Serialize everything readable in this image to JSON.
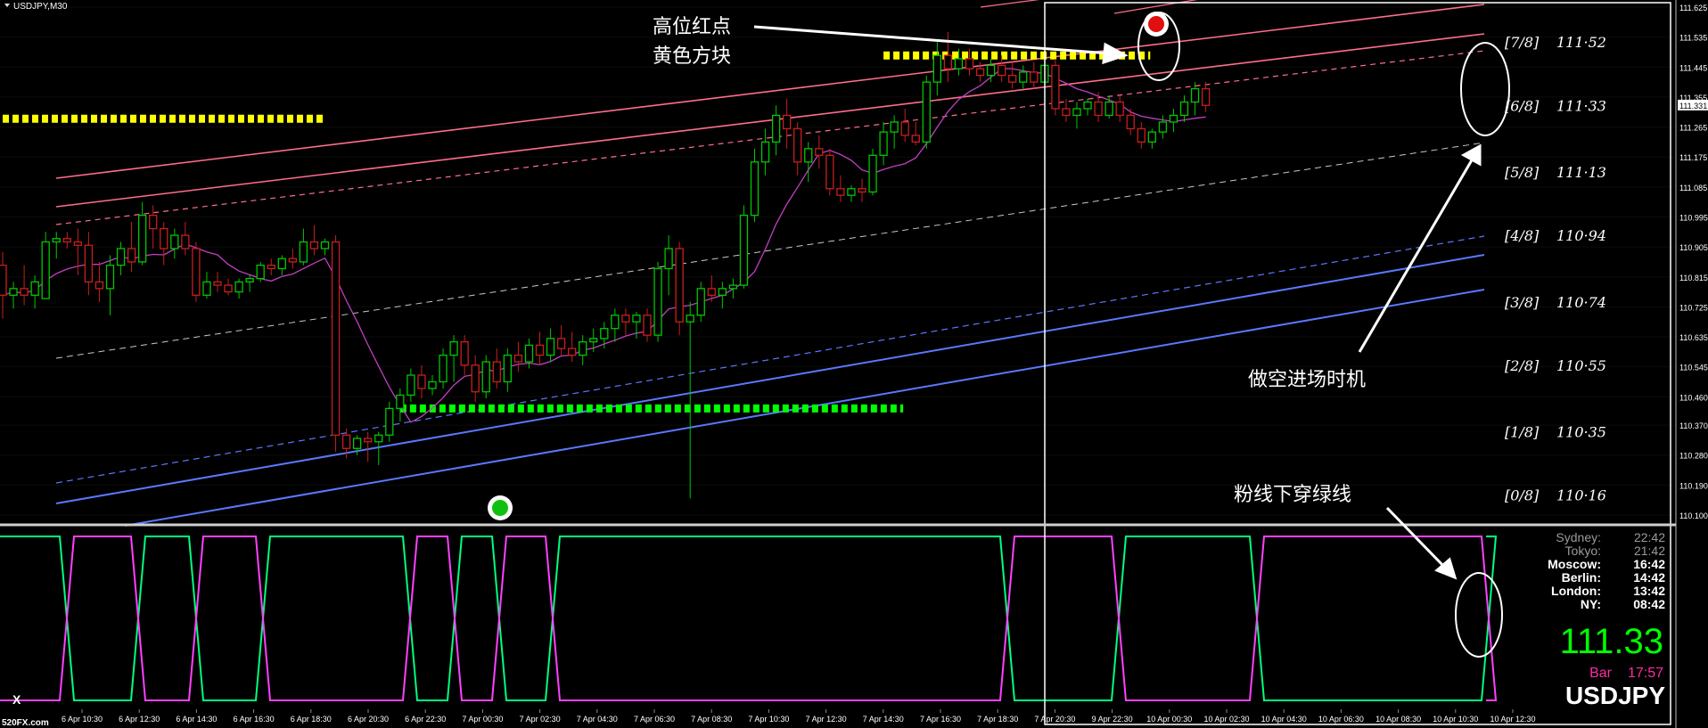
{
  "window": {
    "title": "USDJPY,M30",
    "watermark": "520FX.com",
    "close_label": "X"
  },
  "annotations": {
    "high_red_dot": "高位红点",
    "yellow_block": "黄色方块",
    "short_entry": "做空进场时机",
    "pink_cross_green": "粉线下穿绿线"
  },
  "murrey_levels": [
    {
      "label": "[7/8]",
      "value": "111·52"
    },
    {
      "label": "[6/8]",
      "value": "111·33"
    },
    {
      "label": "[5/8]",
      "value": "111·13"
    },
    {
      "label": "[4/8]",
      "value": "110·94"
    },
    {
      "label": "[3/8]",
      "value": "110·74"
    },
    {
      "label": "[2/8]",
      "value": "110·55"
    },
    {
      "label": "[1/8]",
      "value": "110·35"
    },
    {
      "label": "[0/8]",
      "value": "110·16"
    }
  ],
  "world_clock": [
    {
      "city": "Sydney:",
      "time": "22:42",
      "color": "#9a9a9a"
    },
    {
      "city": "Tokyo:",
      "time": "21:42",
      "color": "#9a9a9a"
    },
    {
      "city": "Moscow:",
      "time": "16:42",
      "color": "#ffffff"
    },
    {
      "city": "Berlin:",
      "time": "14:42",
      "color": "#ffffff"
    },
    {
      "city": "London:",
      "time": "13:42",
      "color": "#ffffff"
    },
    {
      "city": "NY:",
      "time": "08:42",
      "color": "#ffffff"
    }
  ],
  "price_panel": {
    "price": "111.33",
    "bar_label": "Bar",
    "bar_time": "17:57",
    "symbol": "USDJPY"
  },
  "colors": {
    "background": "#000000",
    "bull_candle": "#00c800",
    "bear_candle": "#c81e1e",
    "pink_channel": "#ff6e8c",
    "blue_channel": "#5a78ff",
    "yellow_blocks": "#ffff00",
    "green_blocks": "#00ff00",
    "ma_line": "#c040c0",
    "osc_green": "#00ff7f",
    "osc_pink": "#ff40ff"
  },
  "chart_data": {
    "type": "candlestick",
    "symbol": "USDJPY",
    "timeframe": "M30",
    "ylim": [
      110.1,
      111.625
    ],
    "y_ticks": [
      111.625,
      111.535,
      111.445,
      111.355,
      111.265,
      111.175,
      111.085,
      110.995,
      110.905,
      110.815,
      110.725,
      110.635,
      110.545,
      110.455,
      110.37,
      110.28,
      110.19,
      110.1
    ],
    "y_tick_labels": [
      "111.625",
      "111.535",
      "111.445",
      "111.355",
      "111.265",
      "111.175",
      "111.085",
      "110.995",
      "110.905",
      "110.815",
      "110.725",
      "110.635",
      "110.545",
      "110.460",
      "110.370",
      "110.280",
      "110.190",
      "110.100"
    ],
    "current_price": 111.331,
    "current_price_label": "111.331",
    "x_tick_labels": [
      "6 Apr 10:30",
      "6 Apr 12:30",
      "6 Apr 14:30",
      "6 Apr 16:30",
      "6 Apr 18:30",
      "6 Apr 20:30",
      "6 Apr 22:30",
      "7 Apr 00:30",
      "7 Apr 02:30",
      "7 Apr 04:30",
      "7 Apr 06:30",
      "7 Apr 08:30",
      "7 Apr 10:30",
      "7 Apr 12:30",
      "7 Apr 14:30",
      "7 Apr 16:30",
      "7 Apr 18:30",
      "7 Apr 20:30",
      "9 Apr 22:30",
      "10 Apr 00:30",
      "10 Apr 02:30",
      "10 Apr 04:30",
      "10 Apr 06:30",
      "10 Apr 08:30",
      "10 Apr 10:30",
      "10 Apr 12:30"
    ],
    "murrey_values": [
      111.52,
      111.33,
      111.13,
      110.94,
      110.74,
      110.55,
      110.35,
      110.16
    ],
    "yellow_block_levels": [
      {
        "price": 111.29,
        "from_bar": 0,
        "to_bar": 29
      },
      {
        "price": 111.48,
        "from_bar": 82,
        "to_bar": 106
      }
    ],
    "green_block_levels": [
      {
        "price": 110.42,
        "from_bar": 37,
        "to_bar": 83
      }
    ],
    "candles": [
      {
        "o": 110.85,
        "h": 110.89,
        "l": 110.69,
        "c": 110.76
      },
      {
        "o": 110.76,
        "h": 110.8,
        "l": 110.72,
        "c": 110.78
      },
      {
        "o": 110.78,
        "h": 110.85,
        "l": 110.73,
        "c": 110.76
      },
      {
        "o": 110.76,
        "h": 110.82,
        "l": 110.72,
        "c": 110.8
      },
      {
        "o": 110.75,
        "h": 110.95,
        "l": 110.75,
        "c": 110.92
      },
      {
        "o": 110.92,
        "h": 110.95,
        "l": 110.87,
        "c": 110.93
      },
      {
        "o": 110.93,
        "h": 110.95,
        "l": 110.9,
        "c": 110.92
      },
      {
        "o": 110.92,
        "h": 110.96,
        "l": 110.82,
        "c": 110.91
      },
      {
        "o": 110.91,
        "h": 110.95,
        "l": 110.76,
        "c": 110.8
      },
      {
        "o": 110.8,
        "h": 110.86,
        "l": 110.74,
        "c": 110.78
      },
      {
        "o": 110.78,
        "h": 110.88,
        "l": 110.7,
        "c": 110.85
      },
      {
        "o": 110.85,
        "h": 110.92,
        "l": 110.82,
        "c": 110.9
      },
      {
        "o": 110.9,
        "h": 110.98,
        "l": 110.83,
        "c": 110.86
      },
      {
        "o": 110.86,
        "h": 111.04,
        "l": 110.85,
        "c": 111.0
      },
      {
        "o": 111.0,
        "h": 111.03,
        "l": 110.9,
        "c": 110.96
      },
      {
        "o": 110.96,
        "h": 110.98,
        "l": 110.85,
        "c": 110.9
      },
      {
        "o": 110.9,
        "h": 110.96,
        "l": 110.87,
        "c": 110.94
      },
      {
        "o": 110.94,
        "h": 110.98,
        "l": 110.88,
        "c": 110.9
      },
      {
        "o": 110.9,
        "h": 110.92,
        "l": 110.74,
        "c": 110.76
      },
      {
        "o": 110.76,
        "h": 110.83,
        "l": 110.75,
        "c": 110.8
      },
      {
        "o": 110.8,
        "h": 110.83,
        "l": 110.77,
        "c": 110.79
      },
      {
        "o": 110.79,
        "h": 110.81,
        "l": 110.76,
        "c": 110.77
      },
      {
        "o": 110.77,
        "h": 110.81,
        "l": 110.75,
        "c": 110.8
      },
      {
        "o": 110.8,
        "h": 110.82,
        "l": 110.77,
        "c": 110.81
      },
      {
        "o": 110.81,
        "h": 110.86,
        "l": 110.8,
        "c": 110.85
      },
      {
        "o": 110.85,
        "h": 110.87,
        "l": 110.82,
        "c": 110.84
      },
      {
        "o": 110.84,
        "h": 110.88,
        "l": 110.82,
        "c": 110.87
      },
      {
        "o": 110.87,
        "h": 110.9,
        "l": 110.84,
        "c": 110.86
      },
      {
        "o": 110.86,
        "h": 110.96,
        "l": 110.85,
        "c": 110.92
      },
      {
        "o": 110.92,
        "h": 110.97,
        "l": 110.88,
        "c": 110.9
      },
      {
        "o": 110.9,
        "h": 110.93,
        "l": 110.88,
        "c": 110.92
      },
      {
        "o": 110.92,
        "h": 110.94,
        "l": 110.29,
        "c": 110.34
      },
      {
        "o": 110.34,
        "h": 110.36,
        "l": 110.27,
        "c": 110.3
      },
      {
        "o": 110.3,
        "h": 110.34,
        "l": 110.28,
        "c": 110.33
      },
      {
        "o": 110.33,
        "h": 110.35,
        "l": 110.26,
        "c": 110.32
      },
      {
        "o": 110.32,
        "h": 110.35,
        "l": 110.25,
        "c": 110.34
      },
      {
        "o": 110.34,
        "h": 110.44,
        "l": 110.32,
        "c": 110.42
      },
      {
        "o": 110.42,
        "h": 110.48,
        "l": 110.38,
        "c": 110.46
      },
      {
        "o": 110.46,
        "h": 110.54,
        "l": 110.44,
        "c": 110.52
      },
      {
        "o": 110.52,
        "h": 110.55,
        "l": 110.45,
        "c": 110.48
      },
      {
        "o": 110.48,
        "h": 110.52,
        "l": 110.46,
        "c": 110.5
      },
      {
        "o": 110.5,
        "h": 110.6,
        "l": 110.48,
        "c": 110.58
      },
      {
        "o": 110.58,
        "h": 110.64,
        "l": 110.5,
        "c": 110.62
      },
      {
        "o": 110.62,
        "h": 110.64,
        "l": 110.52,
        "c": 110.55
      },
      {
        "o": 110.55,
        "h": 110.58,
        "l": 110.44,
        "c": 110.47
      },
      {
        "o": 110.47,
        "h": 110.58,
        "l": 110.45,
        "c": 110.56
      },
      {
        "o": 110.56,
        "h": 110.6,
        "l": 110.48,
        "c": 110.5
      },
      {
        "o": 110.5,
        "h": 110.6,
        "l": 110.47,
        "c": 110.58
      },
      {
        "o": 110.58,
        "h": 110.62,
        "l": 110.53,
        "c": 110.56
      },
      {
        "o": 110.56,
        "h": 110.63,
        "l": 110.54,
        "c": 110.61
      },
      {
        "o": 110.61,
        "h": 110.65,
        "l": 110.55,
        "c": 110.58
      },
      {
        "o": 110.58,
        "h": 110.66,
        "l": 110.56,
        "c": 110.63
      },
      {
        "o": 110.63,
        "h": 110.67,
        "l": 110.58,
        "c": 110.6
      },
      {
        "o": 110.6,
        "h": 110.65,
        "l": 110.56,
        "c": 110.58
      },
      {
        "o": 110.58,
        "h": 110.64,
        "l": 110.55,
        "c": 110.62
      },
      {
        "o": 110.62,
        "h": 110.66,
        "l": 110.59,
        "c": 110.63
      },
      {
        "o": 110.63,
        "h": 110.68,
        "l": 110.6,
        "c": 110.66
      },
      {
        "o": 110.66,
        "h": 110.72,
        "l": 110.62,
        "c": 110.7
      },
      {
        "o": 110.7,
        "h": 110.72,
        "l": 110.64,
        "c": 110.68
      },
      {
        "o": 110.68,
        "h": 110.71,
        "l": 110.63,
        "c": 110.7
      },
      {
        "o": 110.7,
        "h": 110.72,
        "l": 110.62,
        "c": 110.64
      },
      {
        "o": 110.64,
        "h": 110.86,
        "l": 110.62,
        "c": 110.84
      },
      {
        "o": 110.84,
        "h": 110.94,
        "l": 110.76,
        "c": 110.9
      },
      {
        "o": 110.9,
        "h": 110.92,
        "l": 110.64,
        "c": 110.68
      },
      {
        "o": 110.68,
        "h": 110.74,
        "l": 110.15,
        "c": 110.7
      },
      {
        "o": 110.7,
        "h": 110.8,
        "l": 110.68,
        "c": 110.78
      },
      {
        "o": 110.78,
        "h": 110.82,
        "l": 110.74,
        "c": 110.76
      },
      {
        "o": 110.76,
        "h": 110.8,
        "l": 110.72,
        "c": 110.78
      },
      {
        "o": 110.78,
        "h": 110.81,
        "l": 110.75,
        "c": 110.79
      },
      {
        "o": 110.79,
        "h": 111.03,
        "l": 110.78,
        "c": 111.0
      },
      {
        "o": 111.0,
        "h": 111.2,
        "l": 110.98,
        "c": 111.16
      },
      {
        "o": 111.16,
        "h": 111.26,
        "l": 111.12,
        "c": 111.22
      },
      {
        "o": 111.22,
        "h": 111.33,
        "l": 111.18,
        "c": 111.3
      },
      {
        "o": 111.3,
        "h": 111.35,
        "l": 111.2,
        "c": 111.26
      },
      {
        "o": 111.26,
        "h": 111.28,
        "l": 111.12,
        "c": 111.16
      },
      {
        "o": 111.16,
        "h": 111.22,
        "l": 111.1,
        "c": 111.2
      },
      {
        "o": 111.2,
        "h": 111.24,
        "l": 111.14,
        "c": 111.18
      },
      {
        "o": 111.18,
        "h": 111.2,
        "l": 111.06,
        "c": 111.08
      },
      {
        "o": 111.08,
        "h": 111.12,
        "l": 111.04,
        "c": 111.06
      },
      {
        "o": 111.06,
        "h": 111.09,
        "l": 111.04,
        "c": 111.08
      },
      {
        "o": 111.08,
        "h": 111.11,
        "l": 111.04,
        "c": 111.07
      },
      {
        "o": 111.07,
        "h": 111.2,
        "l": 111.06,
        "c": 111.18
      },
      {
        "o": 111.18,
        "h": 111.28,
        "l": 111.15,
        "c": 111.25
      },
      {
        "o": 111.25,
        "h": 111.3,
        "l": 111.2,
        "c": 111.28
      },
      {
        "o": 111.28,
        "h": 111.32,
        "l": 111.22,
        "c": 111.24
      },
      {
        "o": 111.24,
        "h": 111.28,
        "l": 111.21,
        "c": 111.22
      },
      {
        "o": 111.22,
        "h": 111.42,
        "l": 111.2,
        "c": 111.4
      },
      {
        "o": 111.4,
        "h": 111.52,
        "l": 111.36,
        "c": 111.48
      },
      {
        "o": 111.48,
        "h": 111.55,
        "l": 111.4,
        "c": 111.44
      },
      {
        "o": 111.44,
        "h": 111.5,
        "l": 111.42,
        "c": 111.47
      },
      {
        "o": 111.47,
        "h": 111.5,
        "l": 111.42,
        "c": 111.44
      },
      {
        "o": 111.44,
        "h": 111.46,
        "l": 111.4,
        "c": 111.42
      },
      {
        "o": 111.42,
        "h": 111.47,
        "l": 111.4,
        "c": 111.45
      },
      {
        "o": 111.45,
        "h": 111.48,
        "l": 111.4,
        "c": 111.42
      },
      {
        "o": 111.42,
        "h": 111.46,
        "l": 111.38,
        "c": 111.4
      },
      {
        "o": 111.4,
        "h": 111.45,
        "l": 111.38,
        "c": 111.43
      },
      {
        "o": 111.43,
        "h": 111.46,
        "l": 111.38,
        "c": 111.4
      },
      {
        "o": 111.4,
        "h": 111.47,
        "l": 111.38,
        "c": 111.45
      },
      {
        "o": 111.45,
        "h": 111.47,
        "l": 111.3,
        "c": 111.32
      },
      {
        "o": 111.32,
        "h": 111.35,
        "l": 111.28,
        "c": 111.3
      },
      {
        "o": 111.3,
        "h": 111.34,
        "l": 111.26,
        "c": 111.32
      },
      {
        "o": 111.32,
        "h": 111.35,
        "l": 111.3,
        "c": 111.34
      },
      {
        "o": 111.34,
        "h": 111.37,
        "l": 111.28,
        "c": 111.3
      },
      {
        "o": 111.3,
        "h": 111.36,
        "l": 111.29,
        "c": 111.34
      },
      {
        "o": 111.34,
        "h": 111.36,
        "l": 111.28,
        "c": 111.3
      },
      {
        "o": 111.3,
        "h": 111.32,
        "l": 111.24,
        "c": 111.26
      },
      {
        "o": 111.26,
        "h": 111.28,
        "l": 111.2,
        "c": 111.22
      },
      {
        "o": 111.22,
        "h": 111.26,
        "l": 111.2,
        "c": 111.25
      },
      {
        "o": 111.25,
        "h": 111.3,
        "l": 111.23,
        "c": 111.28
      },
      {
        "o": 111.28,
        "h": 111.32,
        "l": 111.25,
        "c": 111.3
      },
      {
        "o": 111.3,
        "h": 111.36,
        "l": 111.28,
        "c": 111.34
      },
      {
        "o": 111.34,
        "h": 111.4,
        "l": 111.3,
        "c": 111.38
      },
      {
        "o": 111.38,
        "h": 111.4,
        "l": 111.31,
        "c": 111.33
      }
    ]
  }
}
